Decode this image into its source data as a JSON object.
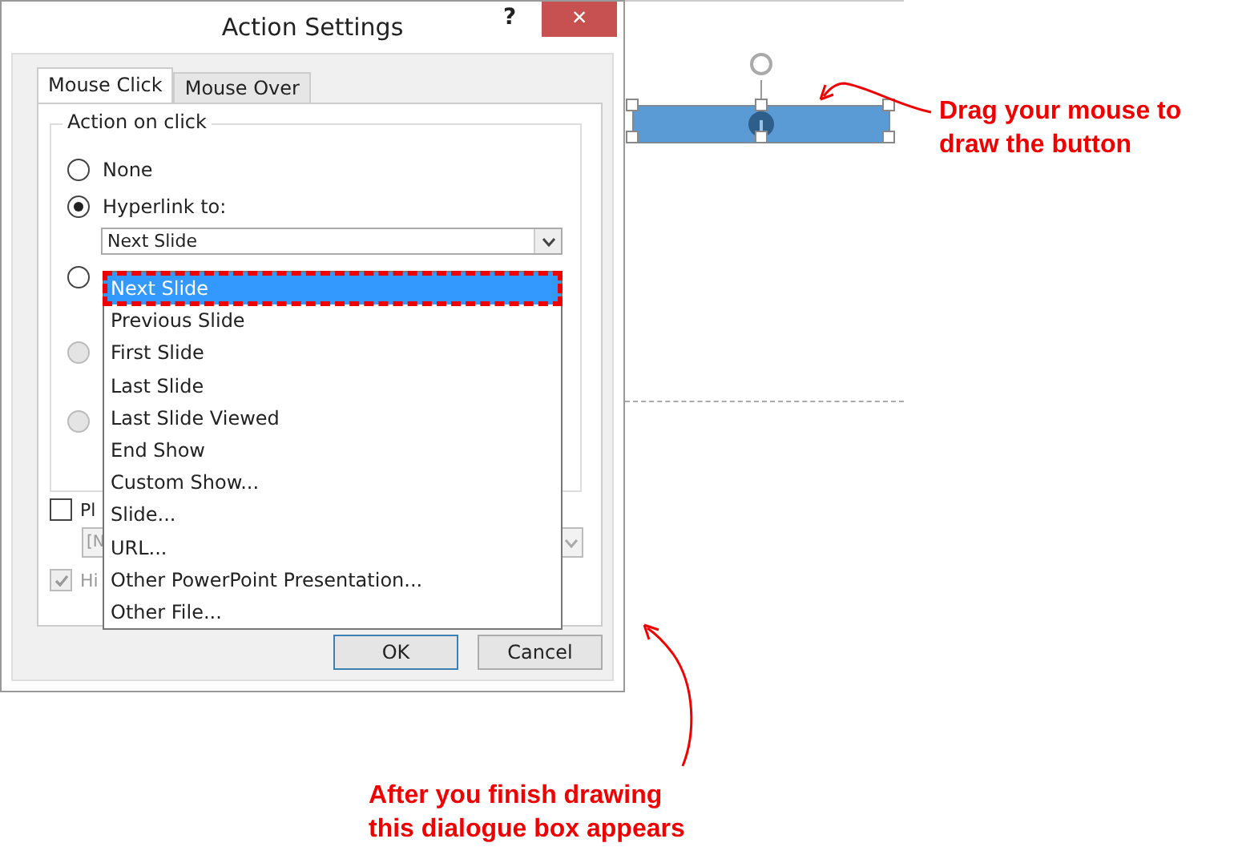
{
  "dialog": {
    "title": "Action Settings",
    "help": "?",
    "close": "×",
    "tabs": [
      {
        "label": "Mouse Click",
        "selected": true
      },
      {
        "label": "Mouse Over",
        "selected": false
      }
    ],
    "group_title": "Action on click",
    "options": [
      {
        "label": "None",
        "selected": false,
        "disabled": false
      },
      {
        "label": "Hyperlink to:",
        "selected": true,
        "disabled": false
      },
      {
        "selected": false,
        "disabled": false
      },
      {
        "selected": false,
        "disabled": true
      },
      {
        "selected": false,
        "disabled": true
      }
    ],
    "hyperlink_combo": {
      "value": "Next Slide"
    },
    "dropdown": {
      "items": [
        {
          "label": "Next Slide",
          "selected": true
        },
        {
          "label": "Previous Slide",
          "selected": false
        },
        {
          "label": "First Slide",
          "selected": false
        },
        {
          "label": "Last Slide",
          "selected": false
        },
        {
          "label": "Last Slide Viewed",
          "selected": false
        },
        {
          "label": "End Show",
          "selected": false
        },
        {
          "label": "Custom Show...",
          "selected": false
        },
        {
          "label": "Slide...",
          "selected": false
        },
        {
          "label": "URL...",
          "selected": false
        },
        {
          "label": "Other PowerPoint Presentation...",
          "selected": false
        },
        {
          "label": "Other File...",
          "selected": false
        }
      ]
    },
    "play_sound": {
      "label": "Pl",
      "checked": false,
      "disabled": false
    },
    "sound_combo": {
      "value": "[N",
      "disabled": true
    },
    "highlight_click": {
      "label": "Hi",
      "checked": true,
      "disabled": true
    },
    "buttons": [
      {
        "label": "OK",
        "default": true
      },
      {
        "label": "Cancel",
        "default": false
      }
    ]
  },
  "annotations": [
    {
      "text": "Drag your mouse to draw the button"
    },
    {
      "text": "After you finish drawing this dialogue box appears"
    }
  ]
}
